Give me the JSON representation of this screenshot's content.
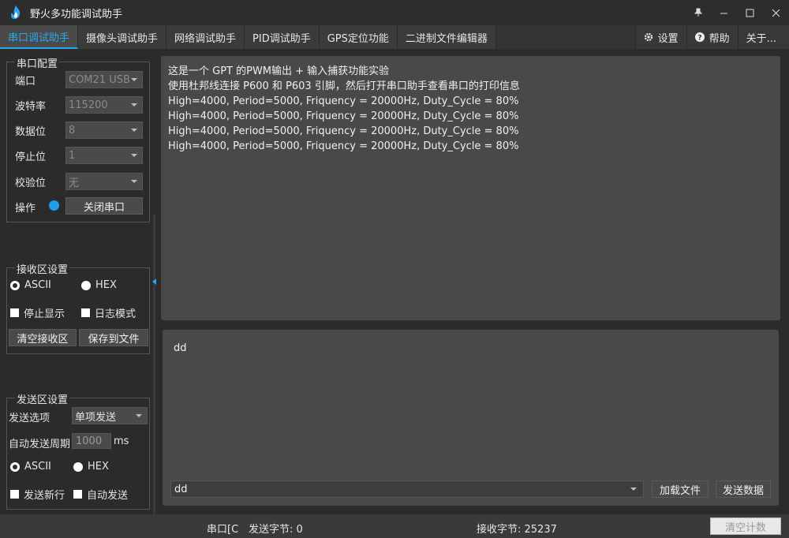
{
  "window": {
    "title": "野火多功能调试助手",
    "controls": {
      "pin": "📌",
      "minimize": "—",
      "maximize": "☐",
      "close": "✕"
    }
  },
  "tabs": [
    {
      "label": "串口调试助手",
      "active": true
    },
    {
      "label": "摄像头调试助手"
    },
    {
      "label": "网络调试助手"
    },
    {
      "label": "PID调试助手"
    },
    {
      "label": "GPS定位功能"
    },
    {
      "label": "二进制文件编辑器"
    }
  ],
  "tabs_right": {
    "settings": "设置",
    "help": "帮助",
    "about": "关于..."
  },
  "serial_config": {
    "title": "串口配置",
    "port_label": "端口",
    "port_value": "COM21 USB",
    "baud_label": "波特率",
    "baud_value": "115200",
    "databits_label": "数据位",
    "databits_value": "8",
    "stopbits_label": "停止位",
    "stopbits_value": "1",
    "parity_label": "校验位",
    "parity_value": "无",
    "operation_label": "操作",
    "close_port_button": "关闭串口"
  },
  "receive_settings": {
    "title": "接收区设置",
    "ascii": "ASCII",
    "hex": "HEX",
    "stop_display": "停止显示",
    "log_mode": "日志模式",
    "clear_button": "清空接收区",
    "save_button": "保存到文件"
  },
  "send_settings": {
    "title": "发送区设置",
    "option_label": "发送选项",
    "option_value": "单项发送",
    "period_label": "自动发送周期",
    "period_value": "1000",
    "period_unit": "ms",
    "ascii": "ASCII",
    "hex": "HEX",
    "newline": "发送新行",
    "auto_send": "自动发送"
  },
  "receive_area": {
    "lines": [
      "这是一个 GPT 的PWM输出 + 输入捕获功能实验",
      "使用杜邦线连接 P600 和 P603 引脚，然后打开串口助手查看串口的打印信息",
      "High=4000, Period=5000, Friquency = 20000Hz, Duty_Cycle = 80%",
      "High=4000, Period=5000, Friquency = 20000Hz, Duty_Cycle = 80%",
      "High=4000, Period=5000, Friquency = 20000Hz, Duty_Cycle = 80%",
      "High=4000, Period=5000, Friquency = 20000Hz, Duty_Cycle = 80%"
    ]
  },
  "send_area": {
    "text": "dd",
    "history_value": "dd",
    "load_file_button": "加载文件",
    "send_button": "发送数据"
  },
  "status": {
    "port": "串口[C",
    "sent": "发送字节: 0",
    "received": "接收字节: 25237",
    "clear_count_button": "清空计数"
  },
  "colors": {
    "accent": "#2aa7ee",
    "panel": "#494949",
    "background": "#2b2b2b"
  }
}
